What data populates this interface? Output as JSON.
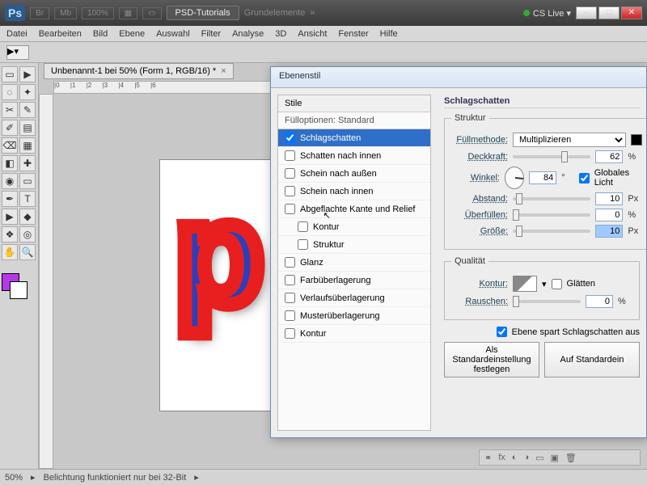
{
  "topbar": {
    "app": "Ps",
    "badges": [
      "Br",
      "Mb"
    ],
    "zoom": "100%",
    "swatches": "▦",
    "workspace_active": "PSD-Tutorials",
    "workspace_other": "Grundelemente",
    "more": "»",
    "cslive": "CS Live"
  },
  "menubar": [
    "Datei",
    "Bearbeiten",
    "Bild",
    "Ebene",
    "Auswahl",
    "Filter",
    "Analyse",
    "3D",
    "Ansicht",
    "Fenster",
    "Hilfe"
  ],
  "doc": {
    "tab": "Unbenannt-1 bei 50% (Form 1, RGB/16) *",
    "close": "×",
    "letter": "p"
  },
  "status": {
    "zoom": "50%",
    "msg": "Belichtung funktioniert nur bei 32-Bit"
  },
  "dialog": {
    "title": "Ebenenstil",
    "styles_head": "Stile",
    "fill_opts": "Fülloptionen: Standard",
    "rows": [
      {
        "label": "Schlagschatten",
        "checked": true,
        "selected": true
      },
      {
        "label": "Schatten nach innen"
      },
      {
        "label": "Schein nach außen"
      },
      {
        "label": "Schein nach innen"
      },
      {
        "label": "Abgeflachte Kante und Relief",
        "checked": false,
        "cursor": true
      },
      {
        "label": "Kontur",
        "sub": true
      },
      {
        "label": "Struktur",
        "sub": true
      },
      {
        "label": "Glanz"
      },
      {
        "label": "Farbüberlagerung"
      },
      {
        "label": "Verlaufsüberlagerung"
      },
      {
        "label": "Musterüberlagerung"
      },
      {
        "label": "Kontur"
      }
    ],
    "right_title": "Schlagschatten",
    "struct_title": "Struktur",
    "blend_label": "Füllmethode:",
    "blend_value": "Multiplizieren",
    "opacity_label": "Deckkraft:",
    "opacity_value": "62",
    "pct": "%",
    "angle_label": "Winkel:",
    "angle_value": "84",
    "deg": "°",
    "global_label": "Globales Licht",
    "distance_label": "Abstand:",
    "distance_value": "10",
    "px": "Px",
    "spread_label": "Überfüllen:",
    "spread_value": "0",
    "size_label": "Größe:",
    "size_value": "10",
    "qual_title": "Qualität",
    "kontur_label": "Kontur:",
    "aa_label": "Glätten",
    "noise_label": "Rauschen:",
    "noise_value": "0",
    "knockout_label": "Ebene spart Schlagschatten aus",
    "btn_default": "Als Standardeinstellung festlegen",
    "btn_reset": "Auf Standardein"
  },
  "tools": [
    "▭",
    "▶",
    "◌",
    "✦",
    "✂",
    "✎",
    "✐",
    "▤",
    "⌫",
    "▦",
    "◧",
    "✚",
    "◉",
    "▭",
    "T",
    "▶",
    "◆",
    "✋",
    "⬚",
    "Q"
  ],
  "colors": {
    "fg": "#b639e8"
  }
}
